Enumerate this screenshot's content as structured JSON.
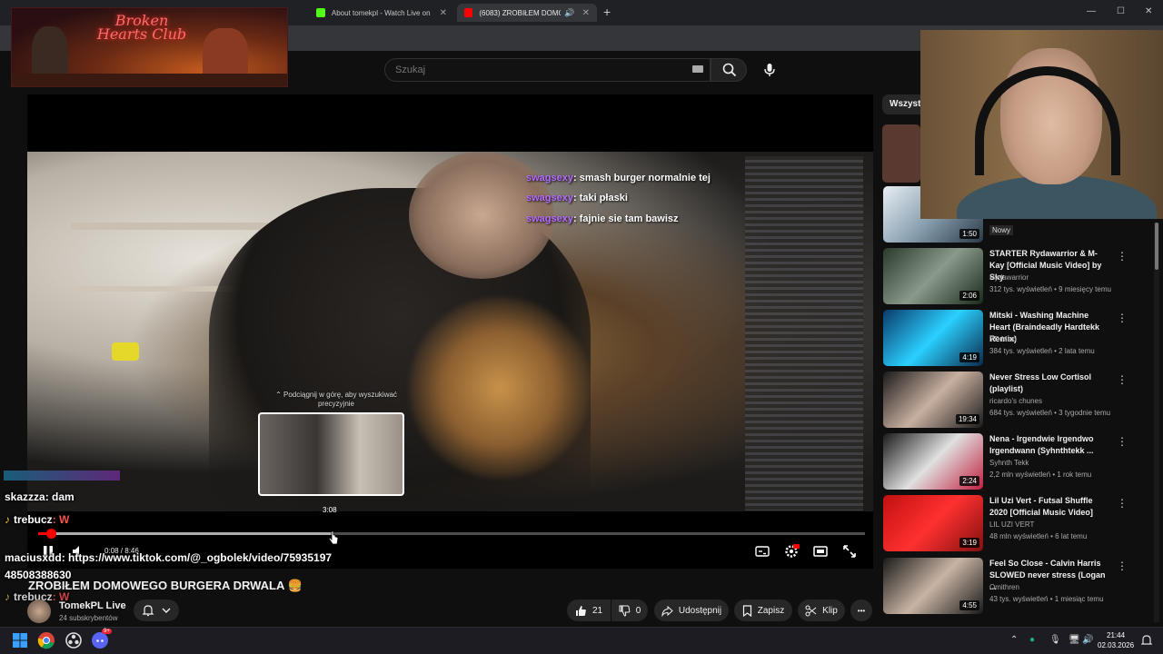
{
  "browser": {
    "tabs": [
      {
        "label": "About tomekpl - Watch Live on",
        "favicon_color": "#53fc18"
      },
      {
        "label": "(6083) ZROBIŁEM DOMOWE",
        "favicon_color": "#ff0000"
      }
    ],
    "new_tab": "+",
    "window_controls": [
      "—",
      "☐",
      "✕"
    ]
  },
  "overlay_banner": {
    "title": "Broken Hearts Club"
  },
  "youtube": {
    "search": {
      "placeholder": "Szukaj"
    },
    "player": {
      "chat_overlay": [
        {
          "user": "swagsexy",
          "text": ": smash burger normalnie tej"
        },
        {
          "user": "swagsexy",
          "text": ": taki płaski"
        },
        {
          "user": "swagsexy",
          "text": ": fajnie sie tam bawisz"
        }
      ],
      "scrub_hint": "⌃ Podciągnij w górę, aby wyszukiwać precyzyjnie",
      "preview_time": "3:08",
      "time_display": "0:08 / 8:46",
      "progress_fraction": 0.015,
      "buffer_fraction": 0.357
    },
    "stream_chat": [
      {
        "user": "skazzza",
        "text": ": dam"
      },
      {
        "user": "trebucz",
        "text": ": W",
        "note": "♪"
      },
      {
        "user": "maciusxdd",
        "text": ": https://www.tiktok.com/@_ogbolek/video/75935197"
      },
      {
        "user": "",
        "text": "48508388630"
      },
      {
        "user": "trebucz",
        "text": ": W",
        "note": "♪"
      }
    ],
    "video_title": "ZROBIŁEM DOMOWEGO BURGERA DRWALA 🍔",
    "channel": {
      "name": "TomekPL Live",
      "subs": "24 subskrybentów"
    },
    "actions": {
      "likes": "21",
      "dislikes": "0",
      "share": "Udostępnij",
      "save": "Zapisz",
      "clip": "Klip",
      "more": "•••"
    },
    "filter_chip": "Wszystk",
    "recommendations": [
      {
        "title": "",
        "channel": "",
        "meta": "Nowy",
        "duration": "1:50",
        "thumb": "linear-gradient(135deg,#e8eef2,#8aa0b0,#2a3a48)"
      },
      {
        "title": "STARTER Rydawarrior & M-Kay [Official Music Video] by Sky",
        "channel": "Rydawarrior",
        "meta": "312 tys. wyświetleń • 9 miesięcy temu",
        "duration": "2:06",
        "thumb": "linear-gradient(135deg,#2a3a2a,#8a9a8a,#1a2a1a)"
      },
      {
        "title": "Mitski - Washing Machine Heart (Braindeadly Hardtekk Remix)",
        "channel": "YF-Maxi",
        "meta": "384 tys. wyświetleń • 2 lata temu",
        "duration": "4:19",
        "thumb": "linear-gradient(135deg,#0a3a6a,#2ad0ff,#0a2a4a)"
      },
      {
        "title": "Never Stress Low Cortisol (playlist)",
        "channel": "ricardo's chunes",
        "meta": "684 tys. wyświetleń • 3 tygodnie temu",
        "duration": "19:34",
        "thumb": "linear-gradient(135deg,#1a1a1a,#c8b0a0,#1a1a1a)"
      },
      {
        "title": "Nena - Irgendwie Irgendwo Irgendwann (Syhnthtekk ...",
        "channel": "Syhnth Tekk",
        "meta": "2,2 mln wyświetleń • 1 rok temu",
        "duration": "2:24",
        "thumb": "linear-gradient(135deg,#1a1a1a,#e0e0e0,#c02040)"
      },
      {
        "title": "Lil Uzi Vert - Futsal Shuffle 2020 [Official Music Video]",
        "channel": "LIL UZI VERT",
        "meta": "48 mln wyświetleń • 6 lat temu",
        "duration": "3:19",
        "thumb": "linear-gradient(135deg,#c01010,#ff3030,#801010)"
      },
      {
        "title": "Feel So Close - Calvin Harris SLOWED never stress (Logan ...",
        "channel": "Omithren",
        "meta": "43 tys. wyświetleń • 1 miesiąc temu",
        "duration": "4:55",
        "thumb": "linear-gradient(135deg,#1a1a1a,#c8b4a4,#1a1a1a)"
      }
    ]
  },
  "taskbar": {
    "clock_time": "21:44",
    "clock_date": "02.03.2026",
    "discord_badge": "9+"
  }
}
